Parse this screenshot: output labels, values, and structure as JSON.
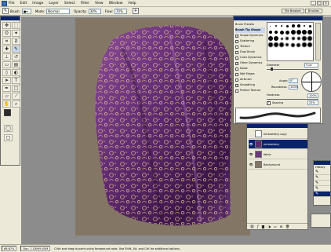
{
  "menubar": {
    "items": [
      "File",
      "Edit",
      "Image",
      "Layer",
      "Select",
      "Filter",
      "View",
      "Window",
      "Help"
    ],
    "controls": [
      "_",
      "□",
      "×"
    ]
  },
  "options_bar": {
    "tool_icon": "brush-icon",
    "brush_label": "Brush:",
    "mode_label": "Mode:",
    "mode_value": "Normal",
    "opacity_label": "Opacity:",
    "opacity_value": "30%",
    "flow_label": "Flow:",
    "flow_value": "70%",
    "bin_tabs": [
      "File Browser",
      "Brushes"
    ]
  },
  "brushes_panel": {
    "menu_items": [
      "Brush Presets",
      "Brush Tip Shape",
      "Shape Dynamics",
      "Scattering",
      "Texture",
      "Dual Brush",
      "Color Dynamics",
      "Other Dynamics",
      "Noise",
      "Wet Edges",
      "Airbrush",
      "Smoothing",
      "Protect Texture"
    ],
    "checked": [
      false,
      false,
      true,
      false,
      false,
      false,
      false,
      true,
      false,
      false,
      false,
      true,
      false
    ],
    "brush_sizes": [
      "1",
      "3",
      "5",
      "9",
      "13",
      "19",
      "5",
      "9",
      "13",
      "17",
      "21",
      "27",
      "35",
      "45",
      "65",
      "100",
      "200",
      "300",
      "9",
      "13",
      "19",
      "17",
      "45",
      "65",
      "100",
      "200",
      "300",
      "14",
      "24",
      "27",
      "39",
      "46"
    ],
    "diameter_label": "Diameter",
    "diameter_value": "5 px",
    "angle_label": "Angle:",
    "angle_value": "0°",
    "roundness_label": "Roundness:",
    "roundness_value": "100%",
    "hardness_label": "Hardness",
    "hardness_value": "100%",
    "spacing_label": "Spacing",
    "spacing_value": "25%"
  },
  "layers_panel": {
    "layers": [
      {
        "name": "embroidery copy",
        "visible": false
      },
      {
        "name": "embroidery",
        "visible": true,
        "selected": true
      },
      {
        "name": "fabric",
        "visible": true
      },
      {
        "name": "Background",
        "visible": true
      }
    ]
  },
  "history_panel": {
    "tab_label": "History"
  },
  "status_bar": {
    "zoom": "66.67%",
    "doc": "Doc: 2.03M/9.05M",
    "hint": "Click and drag to paint using foreground color. Use Shift, Alt, and Ctrl for additional options."
  },
  "colors": {
    "foreground": "#2b2b2b",
    "background": "#3a8a7a",
    "canvas": "#847664",
    "fabric": "#5e2a6e",
    "embroidery": "#e0b38a"
  }
}
